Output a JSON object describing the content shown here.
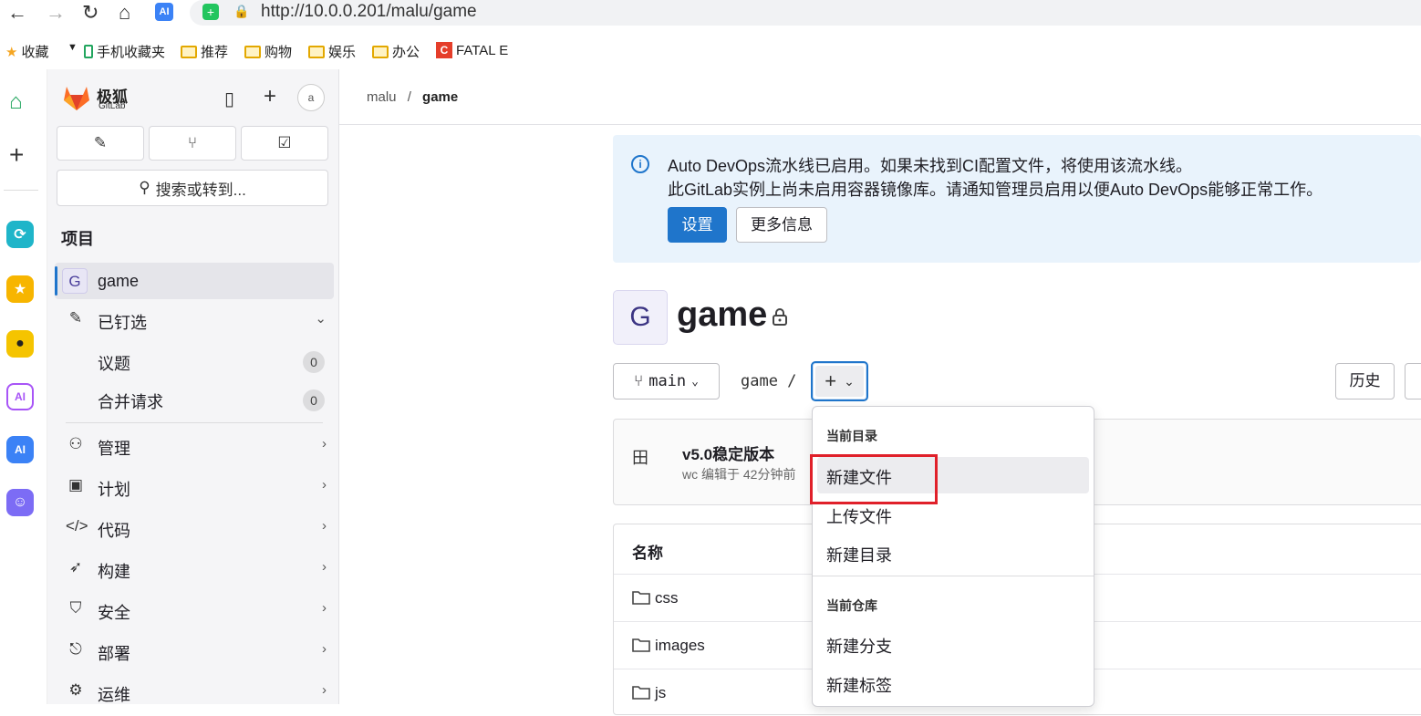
{
  "browser": {
    "url": "http://10.0.0.201/malu/game",
    "bookmarks": [
      "收藏",
      "手机收藏夹",
      "推荐",
      "购物",
      "娱乐",
      "办公",
      "FATAL E"
    ]
  },
  "sidebar": {
    "brand": "极狐",
    "brand_sub": "GitLab",
    "avatar_alt": "a",
    "search_label": "搜索或转到...",
    "section_label": "项目",
    "project": {
      "avatar_letter": "G",
      "name": "game"
    },
    "pinned": {
      "label": "已钉选",
      "items": [
        {
          "label": "议题",
          "count": "0"
        },
        {
          "label": "合并请求",
          "count": "0"
        }
      ]
    },
    "nav": [
      {
        "label": "管理"
      },
      {
        "label": "计划"
      },
      {
        "label": "代码"
      },
      {
        "label": "构建"
      },
      {
        "label": "安全"
      },
      {
        "label": "部署"
      },
      {
        "label": "运维"
      }
    ]
  },
  "breadcrumb": {
    "parent": "malu",
    "separator": "/",
    "current": "game"
  },
  "alert": {
    "line1": "Auto DevOps流水线已启用。如果未找到CI配置文件，将使用该流水线。",
    "line2": "此GitLab实例上尚未启用容器镜像库。请通知管理员启用以便Auto DevOps能够正常工作。",
    "primary_button": "设置",
    "secondary_button": "更多信息"
  },
  "project": {
    "avatar_letter": "G",
    "title": "game"
  },
  "repo": {
    "branch": "main",
    "path": "game /",
    "history_button": "历史"
  },
  "commit": {
    "title": "v5.0稳定版本",
    "meta": "wc 编辑于 42分钟前"
  },
  "files": {
    "header": "名称",
    "rows": [
      {
        "name": "css"
      },
      {
        "name": "images"
      },
      {
        "name": "js"
      }
    ]
  },
  "dropdown": {
    "group1_header": "当前目录",
    "group1_items": [
      "新建文件",
      "上传文件",
      "新建目录"
    ],
    "group2_header": "当前仓库",
    "group2_items": [
      "新建分支",
      "新建标签"
    ]
  },
  "colors": {
    "accent": "#1f75cb",
    "highlight": "#e0202a",
    "alert_bg": "#e9f3fc"
  }
}
